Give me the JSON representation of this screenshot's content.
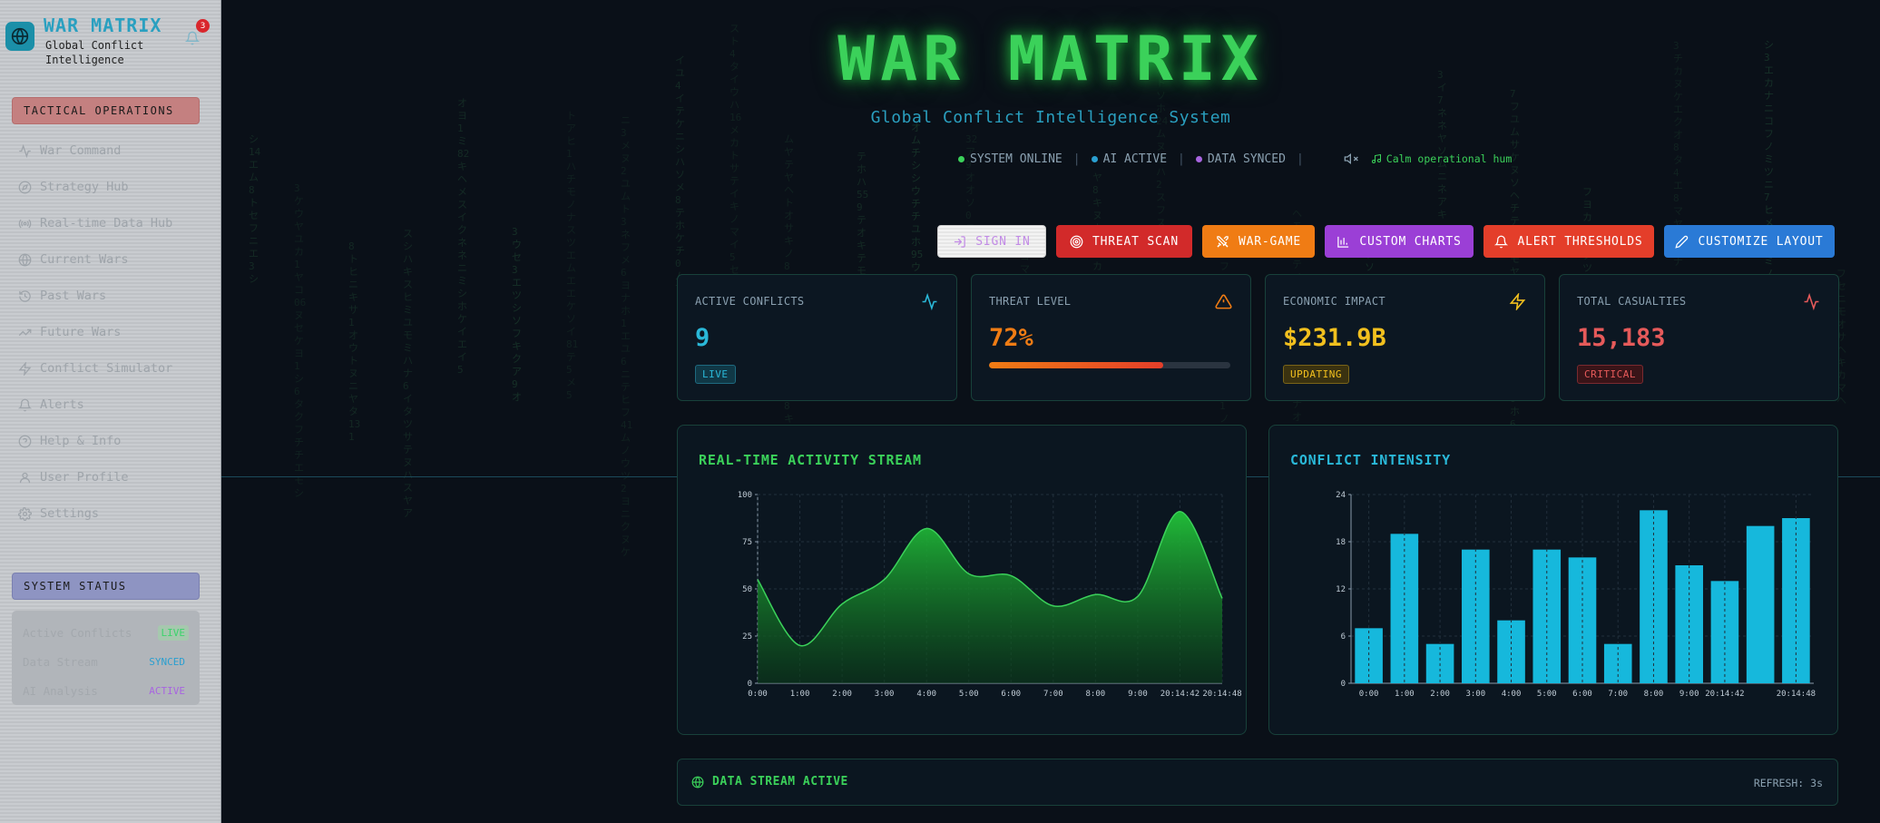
{
  "sidebar": {
    "title": "WAR MATRIX",
    "subtitle": "Global Conflict Intelligence",
    "notification_count": "3",
    "ops_section": "TACTICAL OPERATIONS",
    "nav": [
      {
        "label": "War Command",
        "icon": "activity-icon"
      },
      {
        "label": "Strategy Hub",
        "icon": "compass-icon"
      },
      {
        "label": "Real-time Data Hub",
        "icon": "radio-icon"
      },
      {
        "label": "Current Wars",
        "icon": "globe-icon"
      },
      {
        "label": "Past Wars",
        "icon": "history-icon"
      },
      {
        "label": "Future Wars",
        "icon": "trending-up-icon"
      },
      {
        "label": "Conflict Simulator",
        "icon": "bolt-icon"
      },
      {
        "label": "Alerts",
        "icon": "bell-icon"
      },
      {
        "label": "Help & Info",
        "icon": "help-icon"
      },
      {
        "label": "User Profile",
        "icon": "user-icon"
      },
      {
        "label": "Settings",
        "icon": "gear-icon"
      }
    ],
    "status_section": "SYSTEM STATUS",
    "status": [
      {
        "label": "Active Conflicts",
        "value": "LIVE"
      },
      {
        "label": "Data Stream",
        "value": "SYNCED"
      },
      {
        "label": "AI Analysis",
        "value": "ACTIVE"
      }
    ]
  },
  "header": {
    "title": "WAR MATRIX",
    "subtitle": "Global Conflict Intelligence System",
    "status": [
      "SYSTEM ONLINE",
      "AI ACTIVE",
      "DATA SYNCED"
    ],
    "ambient": "Calm operational hum"
  },
  "buttons": {
    "sign_in": "SIGN IN",
    "threat_scan": "THREAT SCAN",
    "war_game": "WAR-GAME",
    "custom_charts": "CUSTOM CHARTS",
    "alert_thresholds": "ALERT THRESHOLDS",
    "customize_layout": "CUSTOMIZE LAYOUT"
  },
  "cards": {
    "active_conflicts": {
      "label": "ACTIVE CONFLICTS",
      "value": "9",
      "tag": "LIVE"
    },
    "threat_level": {
      "label": "THREAT LEVEL",
      "value": "72%",
      "progress": 0.72
    },
    "economic_impact": {
      "label": "ECONOMIC IMPACT",
      "value": "$231.9B",
      "tag": "UPDATING"
    },
    "total_casualties": {
      "label": "TOTAL CASUALTIES",
      "value": "15,183",
      "tag": "CRITICAL"
    }
  },
  "colors": {
    "green": "#3bd15a",
    "cyan": "#2ab8d8",
    "orange": "#f07c14",
    "yellow": "#f2c01e",
    "red": "#e65a5a"
  },
  "chart_data": [
    {
      "type": "area",
      "title": "REAL-TIME ACTIVITY STREAM",
      "x": [
        "0:00",
        "1:00",
        "2:00",
        "3:00",
        "4:00",
        "5:00",
        "6:00",
        "7:00",
        "8:00",
        "9:00",
        "20:14:42",
        "20:14:48"
      ],
      "values": [
        55,
        20,
        42,
        55,
        82,
        58,
        57,
        41,
        47,
        46,
        91,
        45
      ],
      "ylim": [
        0,
        100
      ],
      "yticks": [
        0,
        25,
        50,
        75,
        100
      ],
      "grid": true
    },
    {
      "type": "bar",
      "title": "CONFLICT INTENSITY",
      "categories": [
        "0:00",
        "1:00",
        "2:00",
        "3:00",
        "4:00",
        "5:00",
        "6:00",
        "7:00",
        "8:00",
        "9:00",
        "20:14:42",
        "",
        "20:14:48"
      ],
      "values": [
        7,
        19,
        5,
        17,
        8,
        17,
        16,
        5,
        22,
        15,
        13,
        20,
        21
      ],
      "ylim": [
        0,
        24
      ],
      "yticks": [
        0,
        6,
        12,
        18,
        24
      ],
      "grid": true
    }
  ],
  "stream": {
    "label": "DATA STREAM ACTIVE",
    "refresh": "REFRESH: 3s"
  }
}
